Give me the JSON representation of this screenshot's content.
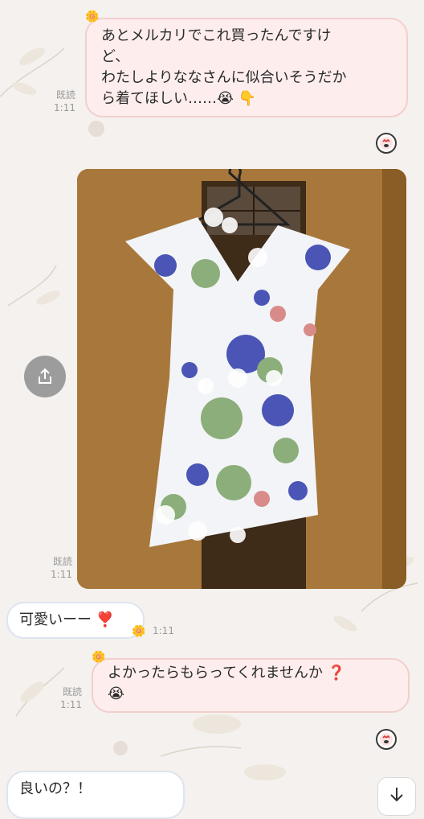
{
  "messages": {
    "msg1": {
      "lines": [
        "あとメルカリでこれ買ったんですけ",
        "ど、",
        "わたしよりななさんに似合いそうだか",
        "ら着てほしい……😭 👇"
      ],
      "read": "既読",
      "time": "1:11"
    },
    "photo": {
      "read": "既読",
      "time": "1:11"
    },
    "msg2": {
      "text": "可愛いーー ❣️",
      "time": "1:11"
    },
    "msg3": {
      "line1": "よかったらもらってくれませんか ❓",
      "line2": "😭",
      "read": "既読",
      "time": "1:11"
    },
    "msg4": {
      "text": "良いの？！"
    }
  },
  "icons": {
    "share": "share-icon",
    "scroll": "arrow-down-icon",
    "reaction": "reaction-badge-icon"
  },
  "colors": {
    "mine_bubble": "#fdeeed",
    "theirs_bubble": "#ffffff"
  }
}
